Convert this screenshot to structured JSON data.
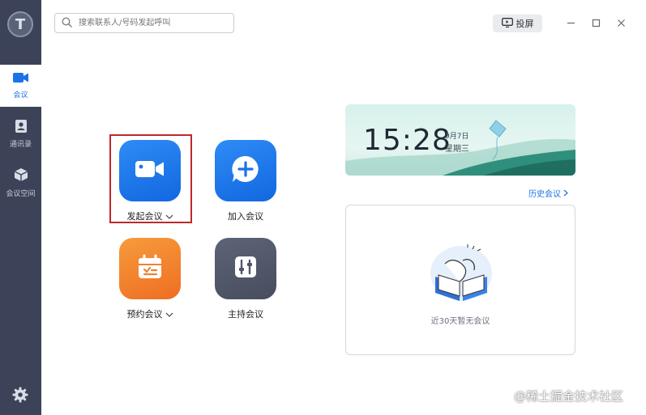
{
  "app": {
    "logo_letter": "T"
  },
  "sidebar": {
    "items": [
      {
        "label": "会议",
        "icon": "video-camera-icon",
        "active": true
      },
      {
        "label": "通讯录",
        "icon": "contacts-icon",
        "active": false
      },
      {
        "label": "会议空间",
        "icon": "cube-icon",
        "active": false
      }
    ],
    "settings_icon": "gear-icon"
  },
  "search": {
    "placeholder": "搜索联系人/号码发起呼叫"
  },
  "toolbar": {
    "cast_label": "投屏"
  },
  "actions": [
    {
      "label": "发起会议",
      "has_dropdown": true,
      "color": "#1a73e8",
      "icon": "video-camera-icon"
    },
    {
      "label": "加入会议",
      "has_dropdown": false,
      "color": "#1a73e8",
      "icon": "plus-bubble-icon"
    },
    {
      "label": "预约会议",
      "has_dropdown": true,
      "color": "#f08030",
      "icon": "calendar-icon"
    },
    {
      "label": "主持会议",
      "has_dropdown": false,
      "color": "#505668",
      "icon": "sliders-icon"
    }
  ],
  "clock": {
    "time": "15:28",
    "date": "9月7日",
    "weekday": "星期三"
  },
  "history": {
    "link_label": "历史会议"
  },
  "empty_state": {
    "text": "近30天暂无会议"
  },
  "watermark": "@稀土掘金技术社区",
  "colors": {
    "accent": "#1a73e8",
    "sidebar_bg": "#3c4358",
    "highlight_border": "#c0282c"
  }
}
